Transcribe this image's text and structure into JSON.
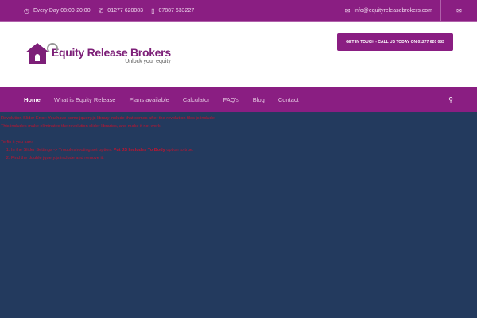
{
  "topbar": {
    "hours": "Every Day 08:00-20:00",
    "phone": "01277 620083",
    "mobile": "07887 633227",
    "email": "info@equityreleasebrokers.com"
  },
  "logo": {
    "title": "Equity Release Brokers",
    "tagline": "Unlock your equity"
  },
  "cta": "GET IN TOUCH - CALL US TODAY ON 01277 620 083",
  "nav": [
    "Home",
    "What is Equity Release",
    "Plans available",
    "Calculator",
    "FAQ's",
    "Blog",
    "Contact"
  ],
  "error": {
    "line1": "Revolution Slider Error: You have some jquery.js library include that comes after the revolution files js include.",
    "line2": "This includes make eliminates the revolution slider libraries, and make it not work.",
    "fix": "To fix it you can:",
    "step1_pre": "In the Slider Settings -> Troubleshooting set option:",
    "step1_bold": "Put JS Includes To Body",
    "step1_post": "option to true.",
    "step2": "Find the double jquery.js include and remove it."
  }
}
